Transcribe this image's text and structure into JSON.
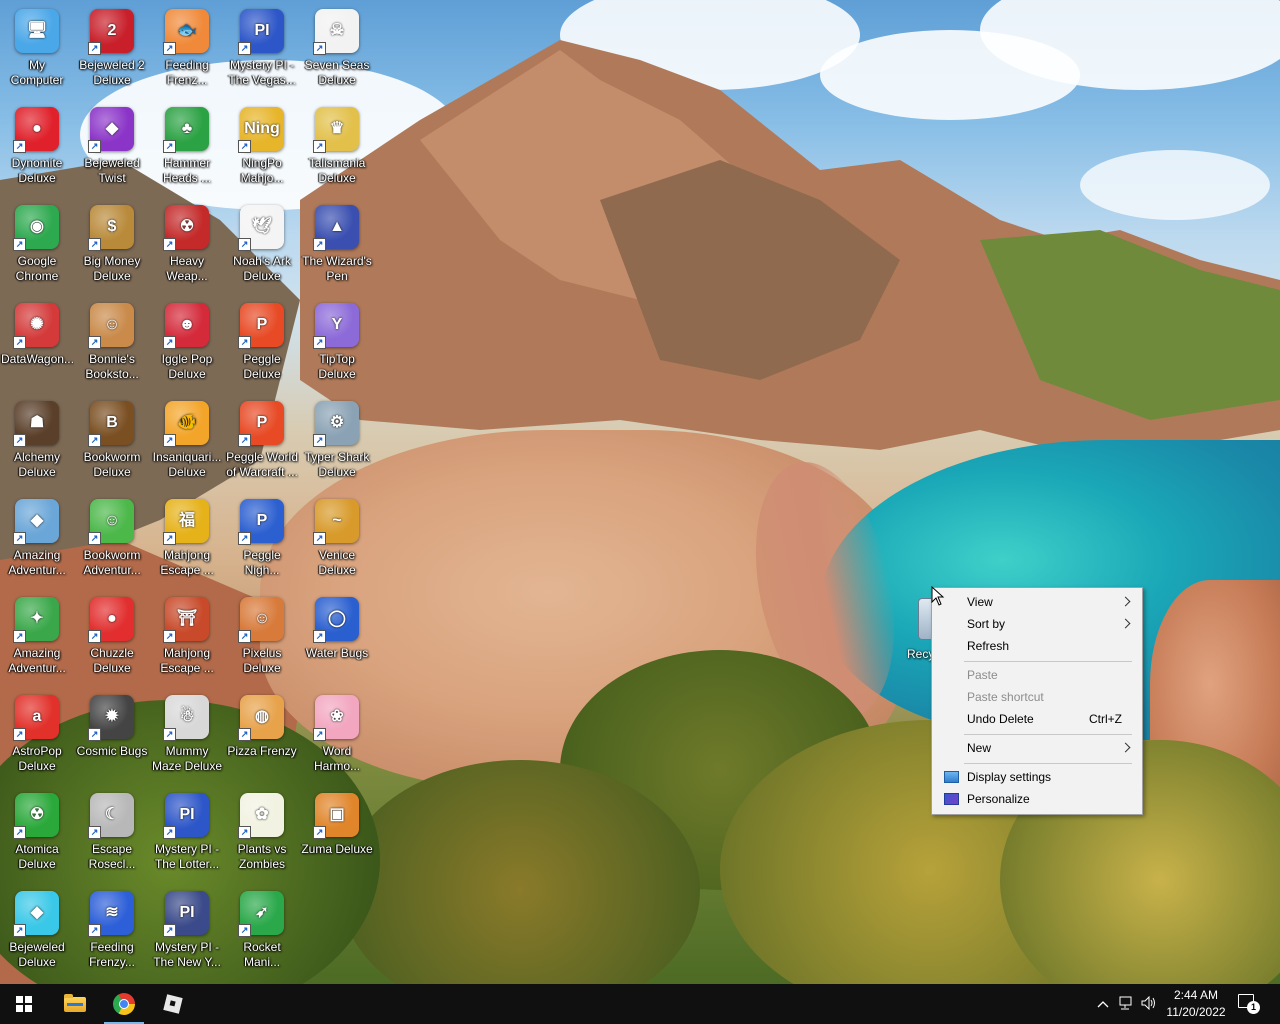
{
  "desktop": {
    "icons": [
      {
        "label": "My Computer",
        "glyph": "🖥",
        "color": "#4aa7e8",
        "shortcut": false
      },
      {
        "label": "Bejeweled 2 Deluxe",
        "glyph": "2",
        "color": "#c81f2a",
        "shortcut": true
      },
      {
        "label": "Feeding Frenz...",
        "glyph": "🐟",
        "color": "#f08a3a",
        "shortcut": true
      },
      {
        "label": "Mystery PI - The Vegas...",
        "glyph": "PI",
        "color": "#2d56c8",
        "shortcut": true
      },
      {
        "label": "Seven Seas Deluxe",
        "glyph": "☠",
        "color": "#f2f2f2",
        "shortcut": true
      },
      {
        "label": "Dynomite Deluxe",
        "glyph": "●",
        "color": "#e0202a",
        "shortcut": true
      },
      {
        "label": "Bejeweled Twist",
        "glyph": "◆",
        "color": "#8b34c8",
        "shortcut": true
      },
      {
        "label": "Hammer Heads ...",
        "glyph": "♣",
        "color": "#2ba243",
        "shortcut": true
      },
      {
        "label": "NingPo Mahjo...",
        "glyph": "Ning",
        "color": "#e7b52a",
        "shortcut": true
      },
      {
        "label": "Talismania Deluxe",
        "glyph": "♛",
        "color": "#e2c04a",
        "shortcut": true
      },
      {
        "label": "Google Chrome",
        "glyph": "◉",
        "color": "#2da94f",
        "shortcut": true
      },
      {
        "label": "Big Money Deluxe",
        "glyph": "$",
        "color": "#b98a3a",
        "shortcut": true
      },
      {
        "label": "Heavy Weap...",
        "glyph": "☢",
        "color": "#c42a2a",
        "shortcut": true
      },
      {
        "label": "Noah's Ark Deluxe",
        "glyph": "🕊",
        "color": "#f4f4f4",
        "shortcut": true
      },
      {
        "label": "The Wizard's Pen",
        "glyph": "▲",
        "color": "#3a4fb0",
        "shortcut": true
      },
      {
        "label": "DataWagon...",
        "glyph": "✺",
        "color": "#d43a3a",
        "shortcut": true
      },
      {
        "label": "Bonnie's Booksto...",
        "glyph": "☺",
        "color": "#c98a4a",
        "shortcut": true
      },
      {
        "label": "Iggle Pop Deluxe",
        "glyph": "☻",
        "color": "#d42a3a",
        "shortcut": true
      },
      {
        "label": "Peggle Deluxe",
        "glyph": "P",
        "color": "#e74a25",
        "shortcut": true
      },
      {
        "label": "TipTop Deluxe",
        "glyph": "Y",
        "color": "#8c6ad8",
        "shortcut": true
      },
      {
        "label": "Alchemy Deluxe",
        "glyph": "☗",
        "color": "#5a3f2a",
        "shortcut": true
      },
      {
        "label": "Bookworm Deluxe",
        "glyph": "B",
        "color": "#7a4f22",
        "shortcut": true
      },
      {
        "label": "Insaniquari... Deluxe",
        "glyph": "🐠",
        "color": "#f3a52a",
        "shortcut": true
      },
      {
        "label": "Peggle World of Warcraft ...",
        "glyph": "P",
        "color": "#e74a25",
        "shortcut": true
      },
      {
        "label": "Typer Shark Deluxe",
        "glyph": "⚙",
        "color": "#8aa2b4",
        "shortcut": true
      },
      {
        "label": "Amazing Adventur...",
        "glyph": "◆",
        "color": "#6aa6d8",
        "shortcut": true
      },
      {
        "label": "Bookworm Adventur...",
        "glyph": "☺",
        "color": "#4cb84a",
        "shortcut": true
      },
      {
        "label": "Mahjong Escape ...",
        "glyph": "福",
        "color": "#e6b21a",
        "shortcut": true
      },
      {
        "label": "Peggle Nigh...",
        "glyph": "P",
        "color": "#2c5fd0",
        "shortcut": true
      },
      {
        "label": "Venice Deluxe",
        "glyph": "~",
        "color": "#d89a2a",
        "shortcut": true
      },
      {
        "label": "Amazing Adventur...",
        "glyph": "✦",
        "color": "#3aa84a",
        "shortcut": true
      },
      {
        "label": "Chuzzle Deluxe",
        "glyph": "●",
        "color": "#e22e2e",
        "shortcut": true
      },
      {
        "label": "Mahjong Escape ...",
        "glyph": "⛩",
        "color": "#c84a2a",
        "shortcut": true
      },
      {
        "label": "Pixelus Deluxe",
        "glyph": "☺",
        "color": "#d87a3a",
        "shortcut": true
      },
      {
        "label": "Water Bugs",
        "glyph": "◯",
        "color": "#2a5fd0",
        "shortcut": true
      },
      {
        "label": "AstroPop Deluxe",
        "glyph": "a",
        "color": "#e2302a",
        "shortcut": true
      },
      {
        "label": "Cosmic Bugs",
        "glyph": "✹",
        "color": "#444444",
        "shortcut": true
      },
      {
        "label": "Mummy Maze Deluxe",
        "glyph": "☃",
        "color": "#d8d8d8",
        "shortcut": true
      },
      {
        "label": "Pizza Frenzy",
        "glyph": "◍",
        "color": "#e7a24a",
        "shortcut": true
      },
      {
        "label": "Word Harmo...",
        "glyph": "❀",
        "color": "#f2a6c0",
        "shortcut": true
      },
      {
        "label": "Atomica Deluxe",
        "glyph": "☢",
        "color": "#2aa83a",
        "shortcut": true
      },
      {
        "label": "Escape Rosecl...",
        "glyph": "☾",
        "color": "#b8b8b8",
        "shortcut": true
      },
      {
        "label": "Mystery PI - The Lotter...",
        "glyph": "PI",
        "color": "#2d56c8",
        "shortcut": true
      },
      {
        "label": "Plants vs Zombies",
        "glyph": "✿",
        "color": "#f2f2e2",
        "shortcut": true
      },
      {
        "label": "Zuma Deluxe",
        "glyph": "▣",
        "color": "#e0852a",
        "shortcut": true
      },
      {
        "label": "Bejeweled Deluxe",
        "glyph": "◆",
        "color": "#3ac8e8",
        "shortcut": true
      },
      {
        "label": "Feeding Frenzy...",
        "glyph": "≋",
        "color": "#2d5fd8",
        "shortcut": true
      },
      {
        "label": "Mystery PI - The New Y...",
        "glyph": "PI",
        "color": "#3a4a8a",
        "shortcut": true
      },
      {
        "label": "Rocket Mani...",
        "glyph": "➶",
        "color": "#2aa84a",
        "shortcut": true
      }
    ],
    "recycle_bin": {
      "label": "Recy"
    }
  },
  "context_menu": {
    "items": [
      {
        "label": "View",
        "submenu": true,
        "disabled": false
      },
      {
        "label": "Sort by",
        "submenu": true,
        "disabled": false
      },
      {
        "label": "Refresh",
        "submenu": false,
        "disabled": false
      },
      {
        "label": "Paste",
        "submenu": false,
        "disabled": true
      },
      {
        "label": "Paste shortcut",
        "submenu": false,
        "disabled": true
      },
      {
        "label": "Undo Delete",
        "shortcut": "Ctrl+Z",
        "submenu": false,
        "disabled": false
      },
      {
        "label": "New",
        "submenu": true,
        "disabled": false
      },
      {
        "label": "Display settings",
        "icon": "display-icon",
        "submenu": false,
        "disabled": false
      },
      {
        "label": "Personalize",
        "icon": "personalize-icon",
        "submenu": false,
        "disabled": false
      }
    ]
  },
  "taskbar": {
    "apps": [
      {
        "name": "start-button",
        "icon": "windows-logo-icon",
        "active": false
      },
      {
        "name": "file-explorer",
        "icon": "folder-icon",
        "active": false
      },
      {
        "name": "google-chrome",
        "icon": "chrome-icon",
        "active": true
      },
      {
        "name": "roblox",
        "icon": "roblox-icon",
        "active": false
      }
    ],
    "tray": {
      "icons": [
        "chevron-up-icon",
        "network-icon",
        "volume-icon"
      ]
    },
    "clock": {
      "time": "2:44 AM",
      "date": "11/20/2022"
    },
    "notifications": {
      "count": "1"
    }
  },
  "theme": {
    "menu_bg": "#f2f2f2",
    "taskbar_bg": "#101010",
    "accent": "#76b9ed"
  }
}
